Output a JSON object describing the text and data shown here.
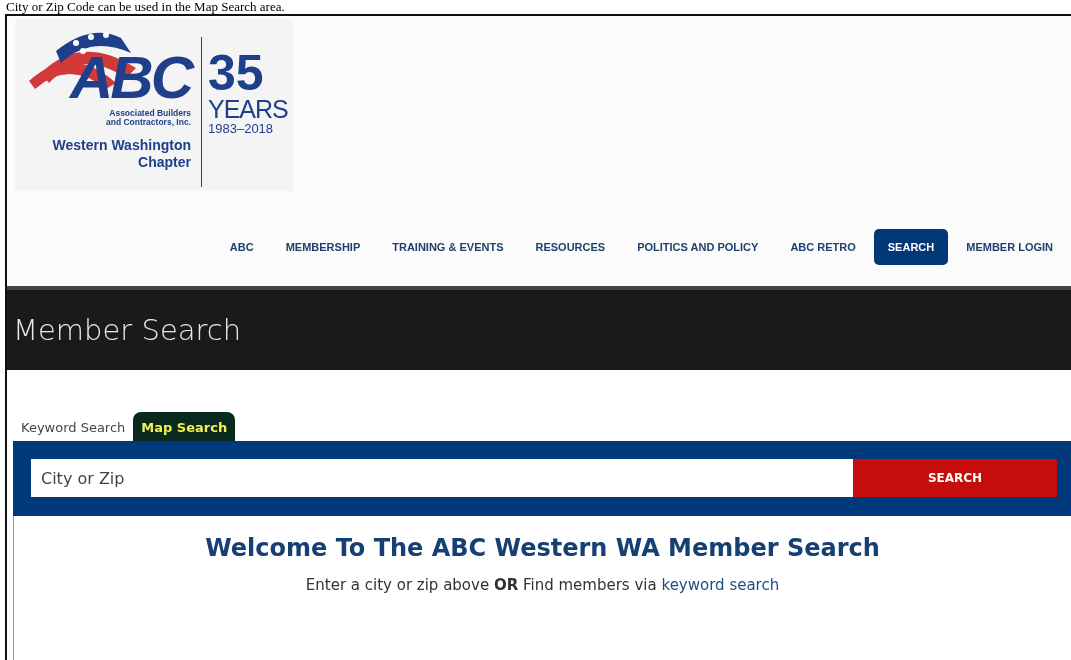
{
  "caption": "City or Zip Code can be used in the Map Search area.",
  "logo": {
    "letters": "ABC",
    "org_line_1": "Associated Builders",
    "org_line_2": "and Contractors, Inc.",
    "chapter_line_1": "Western Washington",
    "chapter_line_2": "Chapter",
    "anniversary_number": "35",
    "anniversary_word": "YEARS",
    "anniversary_range": "1983–2018"
  },
  "nav": [
    {
      "label": "ABC",
      "selected": false
    },
    {
      "label": "MEMBERSHIP",
      "selected": false
    },
    {
      "label": "TRAINING & EVENTS",
      "selected": false
    },
    {
      "label": "RESOURCES",
      "selected": false
    },
    {
      "label": "POLITICS AND POLICY",
      "selected": false
    },
    {
      "label": "ABC RETRO",
      "selected": false
    },
    {
      "label": "SEARCH",
      "selected": true
    },
    {
      "label": "MEMBER LOGIN",
      "selected": false
    }
  ],
  "page_title": "Member Search",
  "tabs": [
    {
      "label": "Keyword Search",
      "selected": false
    },
    {
      "label": "Map Search",
      "selected": true
    }
  ],
  "search": {
    "placeholder": "City or Zip",
    "button": "SEARCH"
  },
  "welcome": {
    "heading": "Welcome To The ABC Western WA Member Search",
    "text_before": "Enter a city or zip above **OR** Find members via",
    "link": "keyword search"
  }
}
